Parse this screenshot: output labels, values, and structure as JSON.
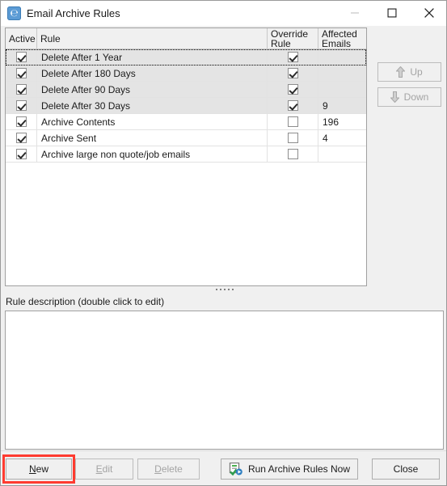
{
  "window": {
    "title": "Email Archive Rules",
    "icon": "email-archive-app-icon",
    "controls": {
      "minimize": "minimize-icon",
      "maximize": "maximize-icon",
      "close": "close-icon"
    }
  },
  "grid": {
    "columns": [
      {
        "key": "active",
        "label": "Active",
        "label2": ""
      },
      {
        "key": "rule",
        "label": "Rule",
        "label2": ""
      },
      {
        "key": "override",
        "label": "Override",
        "label2": "Rule"
      },
      {
        "key": "affected",
        "label": "Affected",
        "label2": "Emails"
      }
    ],
    "rows": [
      {
        "active": true,
        "rule": "Delete After 1 Year",
        "override": true,
        "affected": "",
        "selected": true,
        "focused": true
      },
      {
        "active": true,
        "rule": "Delete After 180 Days",
        "override": true,
        "affected": "",
        "selected": true,
        "focused": false
      },
      {
        "active": true,
        "rule": "Delete After 90 Days",
        "override": true,
        "affected": "",
        "selected": true,
        "focused": false
      },
      {
        "active": true,
        "rule": "Delete After 30 Days",
        "override": true,
        "affected": "9",
        "selected": true,
        "focused": false
      },
      {
        "active": true,
        "rule": "Archive Contents",
        "override": false,
        "affected": "196",
        "selected": false,
        "focused": false
      },
      {
        "active": true,
        "rule": "Archive Sent",
        "override": false,
        "affected": "4",
        "selected": false,
        "focused": false
      },
      {
        "active": true,
        "rule": "Archive large non quote/job emails",
        "override": false,
        "affected": "",
        "selected": false,
        "focused": false
      }
    ]
  },
  "side_buttons": {
    "up": {
      "label": "Up",
      "icon": "arrow-up-icon",
      "enabled": false
    },
    "down": {
      "label": "Down",
      "icon": "arrow-down-icon",
      "enabled": false
    }
  },
  "description": {
    "label": "Rule description (double click to edit)",
    "value": ""
  },
  "bottom_buttons": [
    {
      "key": "new",
      "label": "New",
      "accel": "N",
      "enabled": true,
      "highlighted": true
    },
    {
      "key": "edit",
      "label": "Edit",
      "accel": "E",
      "enabled": false,
      "highlighted": false
    },
    {
      "key": "delete",
      "label": "Delete",
      "accel": "D",
      "enabled": false,
      "highlighted": false
    },
    {
      "key": "run",
      "label": "Run Archive Rules Now",
      "accel": "",
      "enabled": true,
      "highlighted": false,
      "icon": "run-rules-icon"
    },
    {
      "key": "close",
      "label": "Close",
      "accel": "",
      "enabled": true,
      "highlighted": false
    }
  ],
  "colors": {
    "window_bg": "#f0f0f0",
    "titlebar_bg": "#ffffff",
    "selection": "#e4e4e4",
    "accent": "#5b9bd5",
    "highlight_ring": "#ff3b30",
    "disabled_text": "#a4a4a4"
  }
}
